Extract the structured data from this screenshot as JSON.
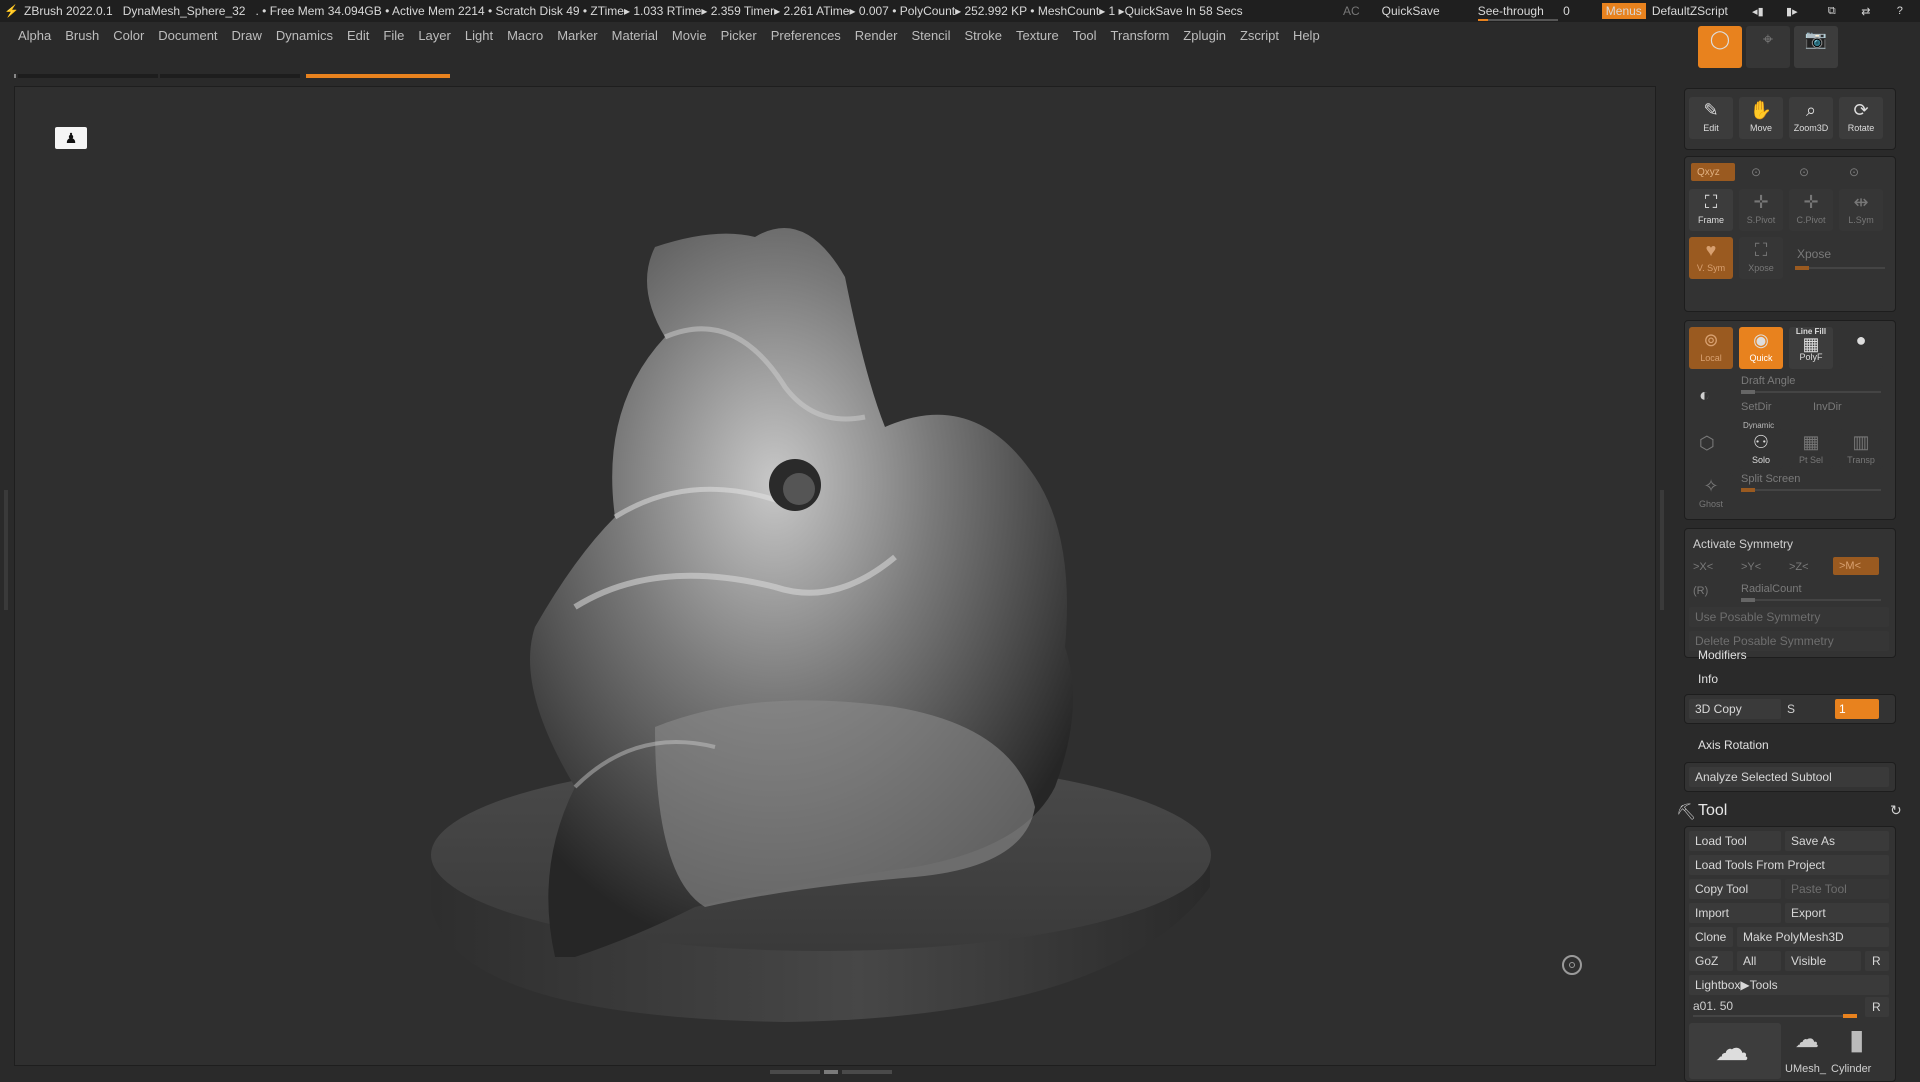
{
  "titlebar": {
    "app": "ZBrush 2022.0.1",
    "document": "DynaMesh_Sphere_32",
    "stats": ". • Free Mem 34.094GB • Active Mem 2214 • Scratch Disk 49 •  ZTime▸ 1.033 RTime▸ 2.359 Timer▸ 2.261 ATime▸ 0.007 • PolyCount▸ 252.992 KP  • MeshCount▸ 1  ▸QuickSave In 58 Secs",
    "ac": "AC",
    "quicksave": "QuickSave",
    "see_through_label": "See-through",
    "see_through_value": "0",
    "menus": "Menus",
    "script": "DefaultZScript"
  },
  "menubar": [
    "Alpha",
    "Brush",
    "Color",
    "Document",
    "Draw",
    "Dynamics",
    "Edit",
    "File",
    "Layer",
    "Light",
    "Macro",
    "Marker",
    "Material",
    "Movie",
    "Picker",
    "Preferences",
    "Render",
    "Stencil",
    "Stroke",
    "Texture",
    "Tool",
    "Transform",
    "Zplugin",
    "Zscript",
    "Help"
  ],
  "transform_buttons": {
    "edit": "Edit",
    "move": "Move",
    "zoom3d": "Zoom3D",
    "rotate": "Rotate",
    "xyz": "Qxyz",
    "frame": "Frame",
    "spivot": "S.Pivot",
    "cpivot": "C.Pivot",
    "lsym": "L.Sym",
    "vsym": "V. Sym",
    "xpose_btn": "Xpose",
    "xpose_label": "Xpose"
  },
  "polyframe": {
    "local": "Local",
    "quick": "Quick",
    "line_fill": "Line Fill",
    "polyf": "PolyF",
    "draft_angle": "Draft Angle",
    "setdir": "SetDir",
    "invdir": "InvDir",
    "dynamic": "Dynamic",
    "solo": "Solo",
    "ptsel": "Pt Sel",
    "transp": "Transp",
    "ghost": "Ghost",
    "split_screen": "Split Screen"
  },
  "symmetry": {
    "title": "Activate Symmetry",
    "x": ">X<",
    "y": ">Y<",
    "z": ">Z<",
    "m": ">M<",
    "r": "(R)",
    "radial": "RadialCount",
    "use_posable": "Use Posable Symmetry",
    "delete_posable": "Delete Posable Symmetry"
  },
  "subpanels": {
    "modifiers": "Modifiers",
    "info": "Info",
    "copy3d": "3D Copy",
    "s": "S",
    "copy3d_value": "1",
    "axis_rotation": "Axis Rotation",
    "analyze": "Analyze Selected Subtool"
  },
  "tool": {
    "title": "Tool",
    "load_tool": "Load Tool",
    "save_as": "Save As",
    "load_from_project": "Load Tools From Project",
    "copy_tool": "Copy Tool",
    "paste_tool": "Paste Tool",
    "import": "Import",
    "export": "Export",
    "clone": "Clone",
    "make_polymesh": "Make PolyMesh3D",
    "goz": "GoZ",
    "all": "All",
    "visible": "Visible",
    "r": "R",
    "lightbox": "Lightbox▶Tools",
    "current": "a01. 50",
    "r2": "R",
    "thumb_umesh": "UMesh_",
    "thumb_cylinder": "Cylinder"
  },
  "colors": {
    "accent": "#e8821e",
    "panel": "#333333",
    "viewport": "#2f2f2f"
  }
}
